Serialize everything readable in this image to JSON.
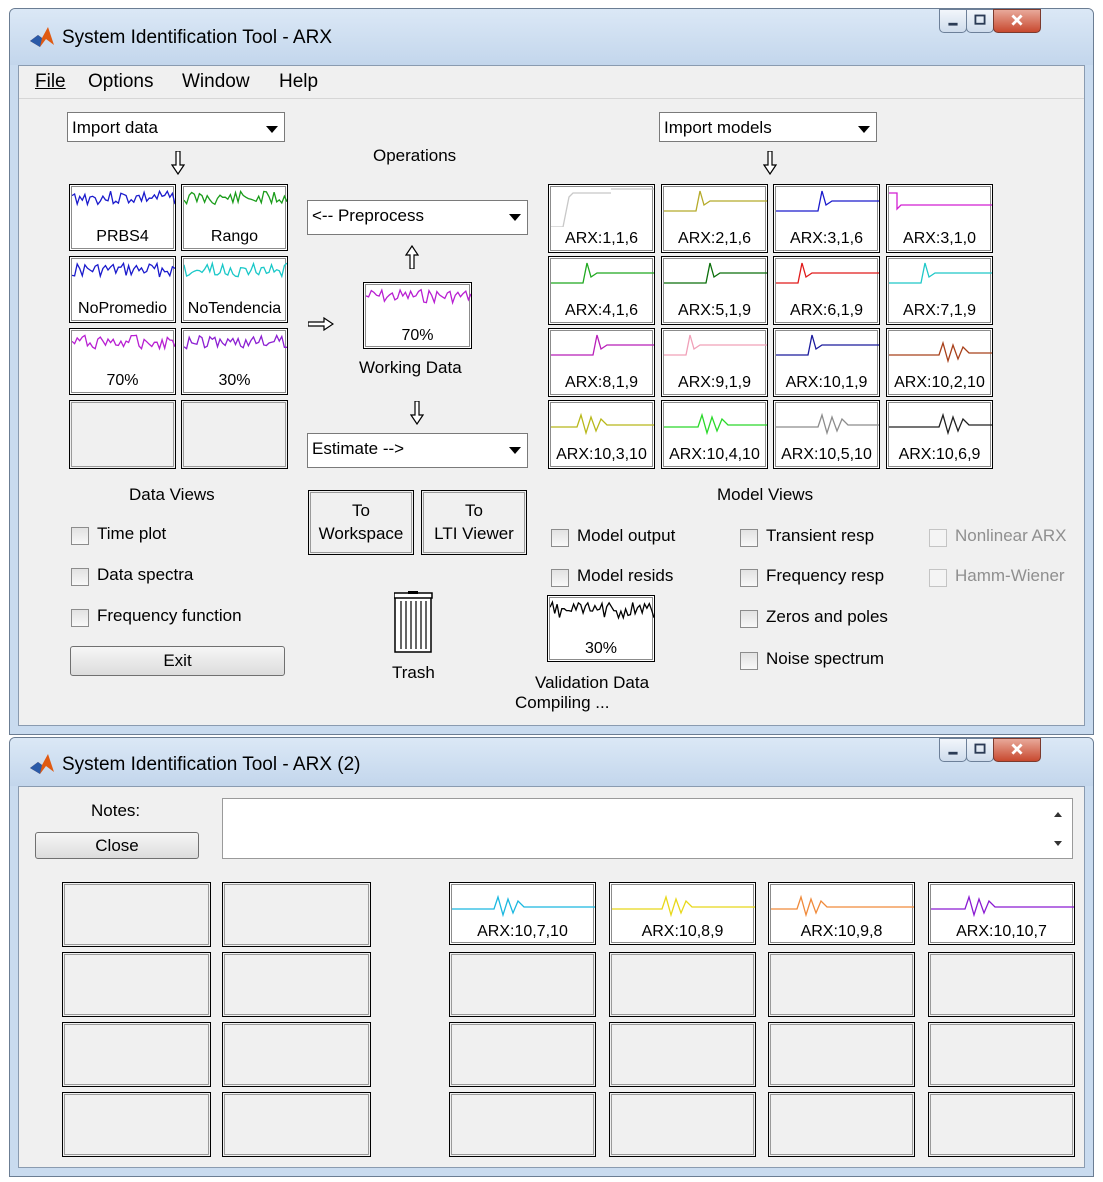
{
  "window1": {
    "title": "System Identification Tool - ARX",
    "menu": {
      "file": "File",
      "options": "Options",
      "window": "Window",
      "help": "Help"
    },
    "import_data": "Import data",
    "import_models": "Import models",
    "operations": "Operations",
    "preprocess": "<-- Preprocess",
    "estimate": "Estimate -->",
    "working_data": {
      "label": "Working Data",
      "value": "70%"
    },
    "data_tiles": [
      "PRBS4",
      "Rango",
      "NoPromedio",
      "NoTendencia",
      "70%",
      "30%"
    ],
    "data_views_label": "Data Views",
    "data_checks": [
      "Time plot",
      "Data spectra",
      "Frequency function"
    ],
    "exit": "Exit",
    "to_workspace": [
      "To",
      "Workspace"
    ],
    "to_lti": [
      "To",
      "LTI Viewer"
    ],
    "trash": "Trash",
    "validation": {
      "value": "30%",
      "label": "Validation Data"
    },
    "status": "Compiling ...",
    "model_tiles": [
      "ARX:1,1,6",
      "ARX:2,1,6",
      "ARX:3,1,6",
      "ARX:3,1,0",
      "ARX:4,1,6",
      "ARX:5,1,9",
      "ARX:6,1,9",
      "ARX:7,1,9",
      "ARX:8,1,9",
      "ARX:9,1,9",
      "ARX:10,1,9",
      "ARX:10,2,10",
      "ARX:10,3,10",
      "ARX:10,4,10",
      "ARX:10,5,10",
      "ARX:10,6,9"
    ],
    "model_colors": [
      "#c8c8c8",
      "#b5aa2a",
      "#1a1acc",
      "#d21fd2",
      "#1fa81f",
      "#0a6e0a",
      "#e01a1a",
      "#1fc8c8",
      "#b81fb8",
      "#f0a0b8",
      "#1a1a9c",
      "#a8401a",
      "#b8b81a",
      "#2ad82a",
      "#8c8c8c",
      "#202020"
    ],
    "data_colors": [
      "#1a1acc",
      "#1a9c1a",
      "#1a1acc",
      "#1ac8c8",
      "#b81fd2",
      "#8c1fd2"
    ],
    "model_views_label": "Model Views",
    "model_checks": [
      "Model output",
      "Model resids"
    ],
    "response_checks": [
      "Transient resp",
      "Frequency resp",
      "Zeros and poles",
      "Noise spectrum"
    ],
    "nonlinear_checks": [
      "Nonlinear ARX",
      "Hamm-Wiener"
    ]
  },
  "window2": {
    "title": "System Identification Tool - ARX (2)",
    "notes_label": "Notes:",
    "close": "Close",
    "model_tiles": [
      "ARX:10,7,10",
      "ARX:10,8,9",
      "ARX:10,9,8",
      "ARX:10,10,7"
    ],
    "model_colors": [
      "#1ab8e0",
      "#e8d81a",
      "#f08a3a",
      "#8a1ad2"
    ]
  }
}
